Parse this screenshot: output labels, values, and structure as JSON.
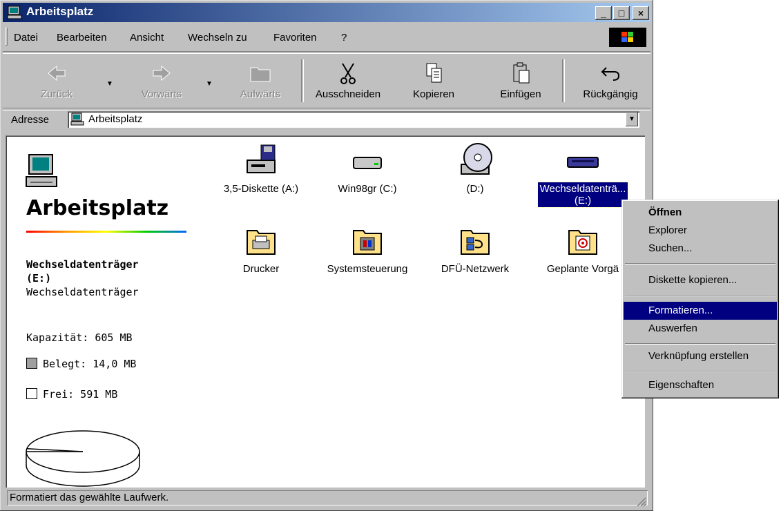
{
  "window": {
    "title": "Arbeitsplatz"
  },
  "titlebar_buttons": {
    "minimize": "_",
    "maximize": "□",
    "close": "×"
  },
  "menubar": {
    "items": [
      "Datei",
      "Bearbeiten",
      "Ansicht",
      "Wechseln zu",
      "Favoriten",
      "?"
    ]
  },
  "toolbar": {
    "back": "Zurück",
    "forward": "Vorwärts",
    "up": "Aufwärts",
    "cut": "Ausschneiden",
    "copy": "Kopieren",
    "paste": "Einfügen",
    "undo": "Rückgängig"
  },
  "address": {
    "label": "Adresse",
    "value": "Arbeitsplatz"
  },
  "left_panel": {
    "title": "Arbeitsplatz",
    "drive_name": "Wechseldatenträger",
    "drive_letter": "(E:)",
    "drive_type": "Wechseldatenträger",
    "capacity": "Kapazität: 605 MB",
    "used": "Belegt: 14,0 MB",
    "free": "Frei: 591 MB",
    "used_fraction": 0.023
  },
  "items": [
    {
      "label": "3,5-Diskette (A:)",
      "icon": "floppy-drive-icon"
    },
    {
      "label": "Win98gr (C:)",
      "icon": "hard-drive-icon"
    },
    {
      "label": "(D:)",
      "icon": "cd-drive-icon"
    },
    {
      "label": "Wechseldatenträ...",
      "label2": "(E:)",
      "icon": "removable-drive-icon",
      "selected": true
    },
    {
      "label": "Drucker",
      "icon": "printers-folder-icon"
    },
    {
      "label": "Systemsteuerung",
      "icon": "control-panel-folder-icon"
    },
    {
      "label": "DFÜ-Netzwerk",
      "icon": "dialup-network-folder-icon"
    },
    {
      "label": "Geplante Vorgä",
      "icon": "scheduled-tasks-folder-icon"
    }
  ],
  "context_menu": {
    "open": "Öffnen",
    "explorer": "Explorer",
    "search": "Suchen...",
    "copy_disk": "Diskette kopieren...",
    "format": "Formatieren...",
    "eject": "Auswerfen",
    "create_shortcut": "Verknüpfung erstellen",
    "properties": "Eigenschaften"
  },
  "status": {
    "text": "Formatiert das gewählte Laufwerk."
  },
  "colors": {
    "titlebar": "#0a246a",
    "selection": "#000080",
    "face": "#c0c0c0"
  }
}
